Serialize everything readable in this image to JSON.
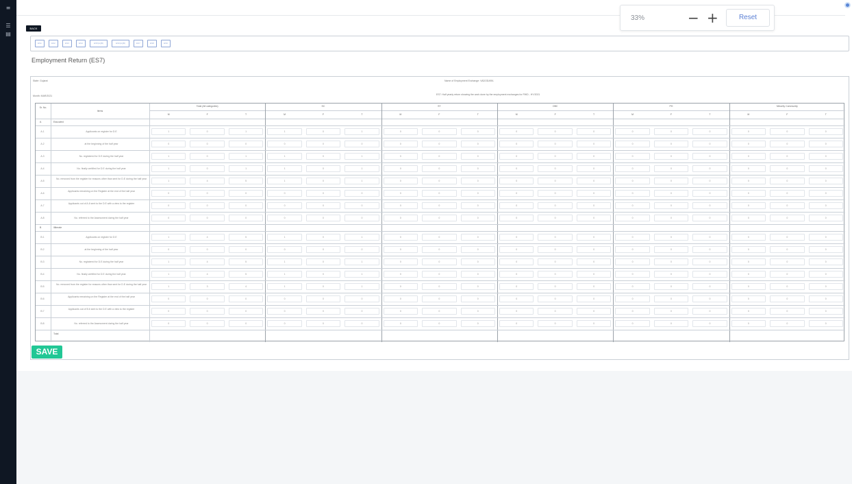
{
  "sidebar": {
    "icons": [
      "menu-icon",
      "list-icon",
      "document-icon"
    ]
  },
  "zoom": {
    "level": "33%",
    "minus": "−",
    "plus": "+",
    "reset": "Reset"
  },
  "back_label": "BACK",
  "tabs": [
    "ES1",
    "ES2",
    "ES3",
    "ES4",
    "ES5(A)(B)",
    "ES6(A)(B)",
    "ES7",
    "ES8",
    "ES9"
  ],
  "page_title": "Employment Return (ES7)",
  "info": {
    "state": "State: Gujarat",
    "exchange": "Name of Employment Exchange: VADODARA",
    "month": "Month: MAR/2021",
    "description": "ES7: Half yearly return showing the work done by the employment exchanges for PWD - HY/2021"
  },
  "table": {
    "sr_header": "Sr. No.",
    "item_header": "Items",
    "groups": [
      "Total (All categories)",
      "SC",
      "ST",
      "OBC",
      "PH",
      "Minority Community"
    ],
    "sub_headers": [
      "M",
      "F",
      "T"
    ],
    "sections": [
      {
        "label": "A",
        "title": "Educated",
        "rows": [
          {
            "no": "A.1",
            "item": "Applicants on register for D.E",
            "values": [
              "1",
              "0",
              "1",
              "1",
              "0",
              "1",
              "0",
              "0",
              "0",
              "0",
              "0",
              "0",
              "0",
              "0",
              "0",
              "0",
              "0",
              "0"
            ]
          },
          {
            "no": "A.2",
            "item": "at the beginning of the half year",
            "values": [
              "0",
              "0",
              "0",
              "0",
              "0",
              "0",
              "0",
              "0",
              "0",
              "0",
              "0",
              "0",
              "0",
              "0",
              "0",
              "0",
              "0",
              "0"
            ]
          },
          {
            "no": "A.3",
            "item": "No. registered for D.E during the half year",
            "values": [
              "1",
              "0",
              "1",
              "1",
              "0",
              "1",
              "0",
              "0",
              "0",
              "0",
              "0",
              "0",
              "0",
              "0",
              "0",
              "0",
              "0",
              "0"
            ]
          },
          {
            "no": "A.4",
            "item": "No. finally certified for D.E during the half year",
            "values": [
              "1",
              "0",
              "1",
              "1",
              "0",
              "1",
              "0",
              "0",
              "0",
              "0",
              "0",
              "0",
              "0",
              "0",
              "0",
              "0",
              "0",
              "0"
            ]
          },
          {
            "no": "A.5",
            "item": "No. removed from the register for reasons other than sent for D.E during the half year",
            "values": [
              "1",
              "4",
              "5",
              "1",
              "0",
              "1",
              "0",
              "0",
              "0",
              "0",
              "0",
              "0",
              "0",
              "0",
              "0",
              "0",
              "0",
              "0"
            ]
          },
          {
            "no": "A.6",
            "item": "Applicants remaining on the Register at the end of the half year",
            "values": [
              "0",
              "0",
              "0",
              "0",
              "0",
              "0",
              "0",
              "0",
              "0",
              "0",
              "0",
              "0",
              "0",
              "0",
              "0",
              "0",
              "0",
              "0"
            ]
          },
          {
            "no": "A.7",
            "item": "Applicants out of A.6 sent to the D.E with a view to the register",
            "values": [
              "0",
              "0",
              "0",
              "0",
              "0",
              "0",
              "0",
              "0",
              "0",
              "0",
              "0",
              "0",
              "0",
              "0",
              "0",
              "0",
              "0",
              "0"
            ]
          },
          {
            "no": "A.8",
            "item": "No. referred to the Assessment during the half year",
            "values": [
              "0",
              "0",
              "0",
              "0",
              "0",
              "0",
              "0",
              "0",
              "0",
              "0",
              "0",
              "0",
              "0",
              "0",
              "0",
              "0",
              "0",
              "0"
            ]
          }
        ]
      },
      {
        "label": "B",
        "title": "Illiterate",
        "rows": [
          {
            "no": "B.1",
            "item": "Applicants on register for D.E",
            "values": [
              "1",
              "4",
              "5",
              "1",
              "0",
              "1",
              "0",
              "0",
              "0",
              "0",
              "0",
              "0",
              "0",
              "0",
              "0",
              "0",
              "0",
              "0"
            ]
          },
          {
            "no": "B.2",
            "item": "at the beginning of the half year",
            "values": [
              "0",
              "0",
              "0",
              "0",
              "0",
              "0",
              "0",
              "0",
              "0",
              "0",
              "0",
              "0",
              "0",
              "0",
              "0",
              "0",
              "0",
              "0"
            ]
          },
          {
            "no": "B.3",
            "item": "No. registered for D.E during the half year",
            "values": [
              "1",
              "4",
              "5",
              "1",
              "0",
              "1",
              "0",
              "0",
              "0",
              "0",
              "0",
              "0",
              "0",
              "0",
              "0",
              "0",
              "0",
              "0"
            ]
          },
          {
            "no": "B.4",
            "item": "No. finally certified for D.E during the half year",
            "values": [
              "1",
              "4",
              "5",
              "1",
              "0",
              "1",
              "0",
              "0",
              "0",
              "0",
              "0",
              "0",
              "0",
              "0",
              "0",
              "0",
              "0",
              "0"
            ]
          },
          {
            "no": "B.5",
            "item": "No. removed from the register for reasons other than sent for D.E during the half year",
            "values": [
              "1",
              "3",
              "4",
              "1",
              "0",
              "1",
              "0",
              "0",
              "0",
              "0",
              "0",
              "0",
              "0",
              "0",
              "0",
              "0",
              "0",
              "0"
            ]
          },
          {
            "no": "B.6",
            "item": "Applicants remaining on the Register at the end of the half year",
            "values": [
              "0",
              "0",
              "0",
              "0",
              "0",
              "0",
              "0",
              "0",
              "0",
              "0",
              "0",
              "0",
              "0",
              "0",
              "0",
              "0",
              "0",
              "0"
            ]
          },
          {
            "no": "B.7",
            "item": "Applicants out of B.6 sent to the D.E with a view to the register",
            "values": [
              "0",
              "0",
              "0",
              "0",
              "0",
              "0",
              "0",
              "0",
              "0",
              "0",
              "0",
              "0",
              "0",
              "0",
              "0",
              "0",
              "0",
              "0"
            ]
          },
          {
            "no": "B.8",
            "item": "No. referred to the Assessment during the half year",
            "values": [
              "0",
              "0",
              "0",
              "0",
              "0",
              "0",
              "0",
              "0",
              "0",
              "0",
              "0",
              "0",
              "0",
              "0",
              "0",
              "0",
              "0",
              "0"
            ]
          }
        ]
      }
    ],
    "total_label": "Total"
  },
  "save_label": "SAVE"
}
